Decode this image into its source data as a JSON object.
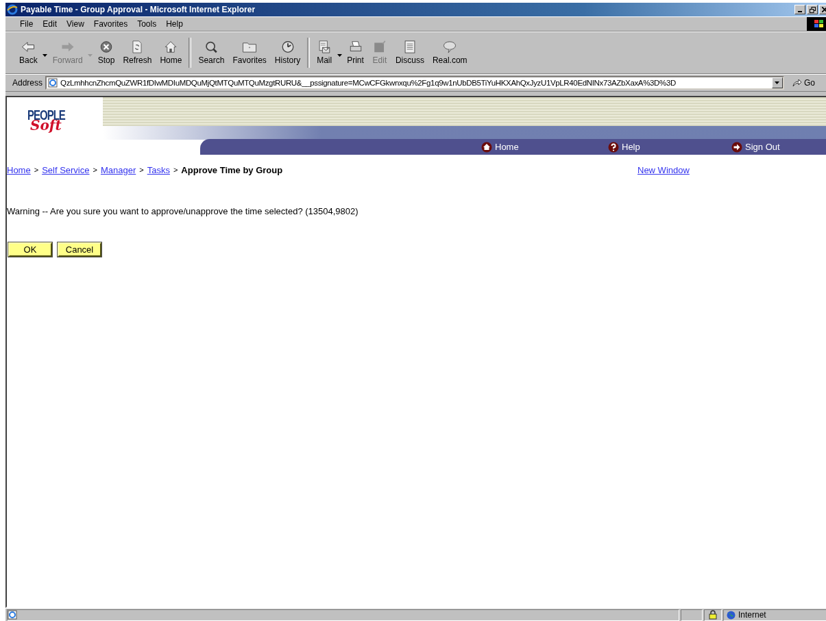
{
  "window": {
    "title": "Payable Time - Group Approval - Microsoft Internet Explorer"
  },
  "menu": [
    "File",
    "Edit",
    "View",
    "Favorites",
    "Tools",
    "Help"
  ],
  "toolbar": [
    [
      {
        "label": "Back",
        "disabled": false,
        "dropdown": true
      },
      {
        "label": "Forward",
        "disabled": true,
        "dropdown": true
      },
      {
        "label": "Stop",
        "disabled": false,
        "dropdown": false
      },
      {
        "label": "Refresh",
        "disabled": false,
        "dropdown": false
      },
      {
        "label": "Home",
        "disabled": false,
        "dropdown": false
      }
    ],
    [
      {
        "label": "Search",
        "disabled": false,
        "dropdown": false
      },
      {
        "label": "Favorites",
        "disabled": false,
        "dropdown": false
      },
      {
        "label": "History",
        "disabled": false,
        "dropdown": false
      }
    ],
    [
      {
        "label": "Mail",
        "disabled": false,
        "dropdown": true
      },
      {
        "label": "Print",
        "disabled": false,
        "dropdown": false
      },
      {
        "label": "Edit",
        "disabled": true,
        "dropdown": false
      },
      {
        "label": "Discuss",
        "disabled": false,
        "dropdown": false
      },
      {
        "label": "Real.com",
        "disabled": false,
        "dropdown": false
      }
    ]
  ],
  "address": {
    "label": "Address",
    "value": "QzLmhhcnZhcmQuZWR1fDIwMDIuMDQuMjQtMTQuMTQuMzgtRURU&__pssignature=MCwCFGkwnxqu%2Fg1q9w1nUbDB5TiYuHKXAhQxJyzU1VpLR40EdNINx73AZbXaxA%3D%3D",
    "go": "Go"
  },
  "portal": {
    "logo_top": "PEOPLE",
    "logo_bottom": "Soft",
    "nav": [
      {
        "label": "Home"
      },
      {
        "label": "Help"
      },
      {
        "label": "Sign Out"
      }
    ]
  },
  "breadcrumb": {
    "separator": ">",
    "links": [
      "Home",
      "Self Service",
      "Manager",
      "Tasks"
    ],
    "current": "Approve Time by Group"
  },
  "new_window": "New Window",
  "message": "Warning -- Are you sure you want to approve/unapprove the time selected? (13504,9802)",
  "buttons": [
    "OK",
    "Cancel"
  ],
  "status_bar": {
    "zone": "Internet"
  }
}
